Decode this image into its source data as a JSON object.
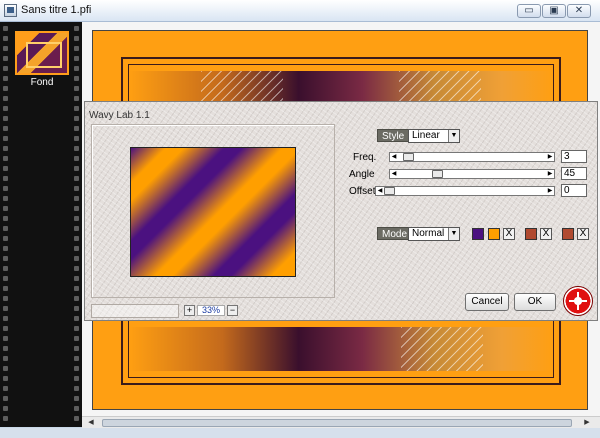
{
  "window": {
    "title": "Sans titre 1.pfi",
    "min_label": "▭",
    "max_label": "▣",
    "close_label": "✕"
  },
  "layers": [
    {
      "label": "Fond"
    }
  ],
  "dialog": {
    "title": "Wavy Lab 1.1",
    "style": {
      "label": "Style",
      "value": "Linear"
    },
    "params": [
      {
        "label": "Freq.",
        "value": "3",
        "fraction": 0.04
      },
      {
        "label": "Angle",
        "value": "45",
        "fraction": 0.25
      },
      {
        "label": "Offset",
        "value": "0",
        "fraction": 0.0
      }
    ],
    "mode": {
      "label": "Mode",
      "value": "Normal"
    },
    "colors": [
      "#4b1180",
      "#ff9f00",
      "#b04a30",
      "#b04a30"
    ],
    "x_label": "X",
    "zoom": {
      "plus": "+",
      "value": "33%",
      "minus": "−"
    },
    "cancel_label": "Cancel",
    "ok_label": "OK"
  }
}
